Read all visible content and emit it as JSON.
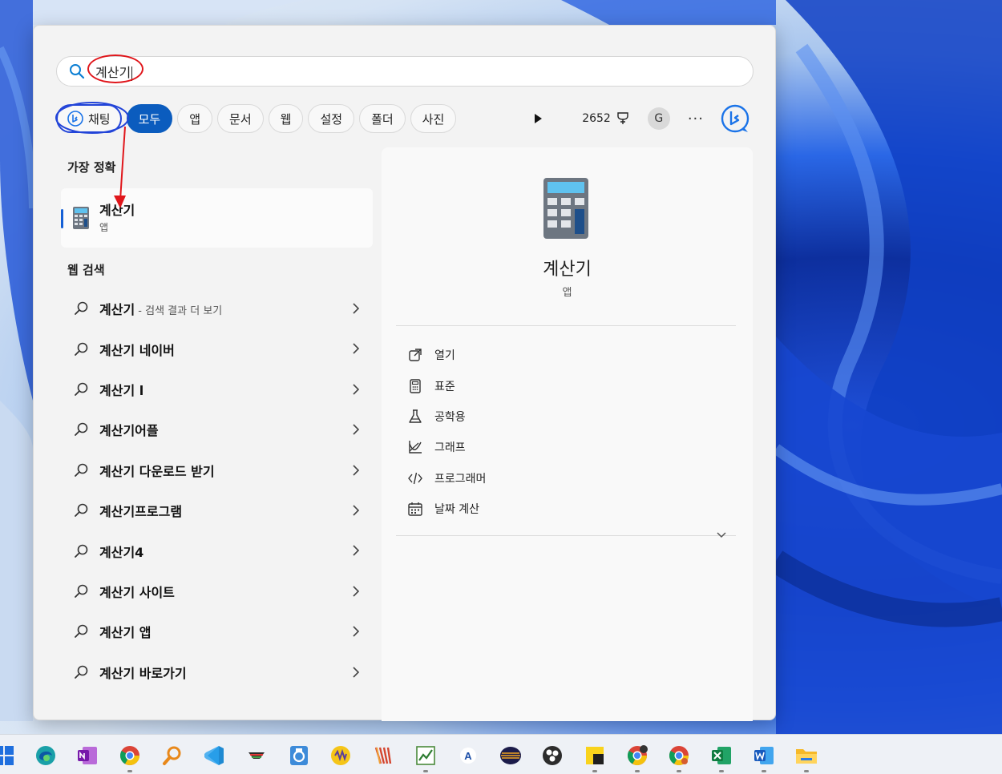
{
  "search": {
    "query": "계산기",
    "icon": "search-icon"
  },
  "filters": {
    "chat_label": "채팅",
    "tabs": [
      "모두",
      "앱",
      "문서",
      "웹",
      "설정",
      "폴더",
      "사진"
    ],
    "points": "2652",
    "avatar_letter": "G",
    "more": "···"
  },
  "best_match": {
    "title": "가장 정확",
    "app_name": "계산기",
    "app_kind": "앱"
  },
  "web_search": {
    "title": "웹 검색",
    "items": [
      {
        "label": "계산기",
        "sub": " - 검색 결과 더 보기"
      },
      {
        "label": "계산기 네이버",
        "sub": ""
      },
      {
        "label": "계산기 l",
        "sub": ""
      },
      {
        "label": "계산기어플",
        "sub": ""
      },
      {
        "label": "계산기 다운로드 받기",
        "sub": ""
      },
      {
        "label": "계산기프로그램",
        "sub": ""
      },
      {
        "label": "계산기4",
        "sub": ""
      },
      {
        "label": "계산기 사이트",
        "sub": ""
      },
      {
        "label": "계산기 앱",
        "sub": ""
      },
      {
        "label": "계산기 바로가기",
        "sub": ""
      }
    ]
  },
  "detail": {
    "app_name": "계산기",
    "app_kind": "앱",
    "actions": [
      {
        "label": "열기",
        "icon": "open-external-icon"
      },
      {
        "label": "표준",
        "icon": "calculator-icon"
      },
      {
        "label": "공학용",
        "icon": "flask-icon"
      },
      {
        "label": "그래프",
        "icon": "graph-icon"
      },
      {
        "label": "프로그래머",
        "icon": "code-icon"
      },
      {
        "label": "날짜 계산",
        "icon": "calendar-icon"
      }
    ]
  },
  "colors": {
    "accent": "#0b5cbe",
    "annotation": "#e0161b",
    "annotation_blue": "#2244d8"
  },
  "taskbar": {
    "icons": [
      "windows-start-icon",
      "edge-icon",
      "onenote-icon",
      "chrome-icon",
      "magnifier-icon",
      "vscode-icon",
      "app-icon",
      "app-icon",
      "app-icon",
      "app-icon",
      "app-icon",
      "app-icon",
      "app-icon",
      "obs-icon",
      "sticky-notes-icon",
      "chrome-icon",
      "chrome-icon",
      "excel-icon",
      "word-icon",
      "file-explorer-icon"
    ]
  }
}
